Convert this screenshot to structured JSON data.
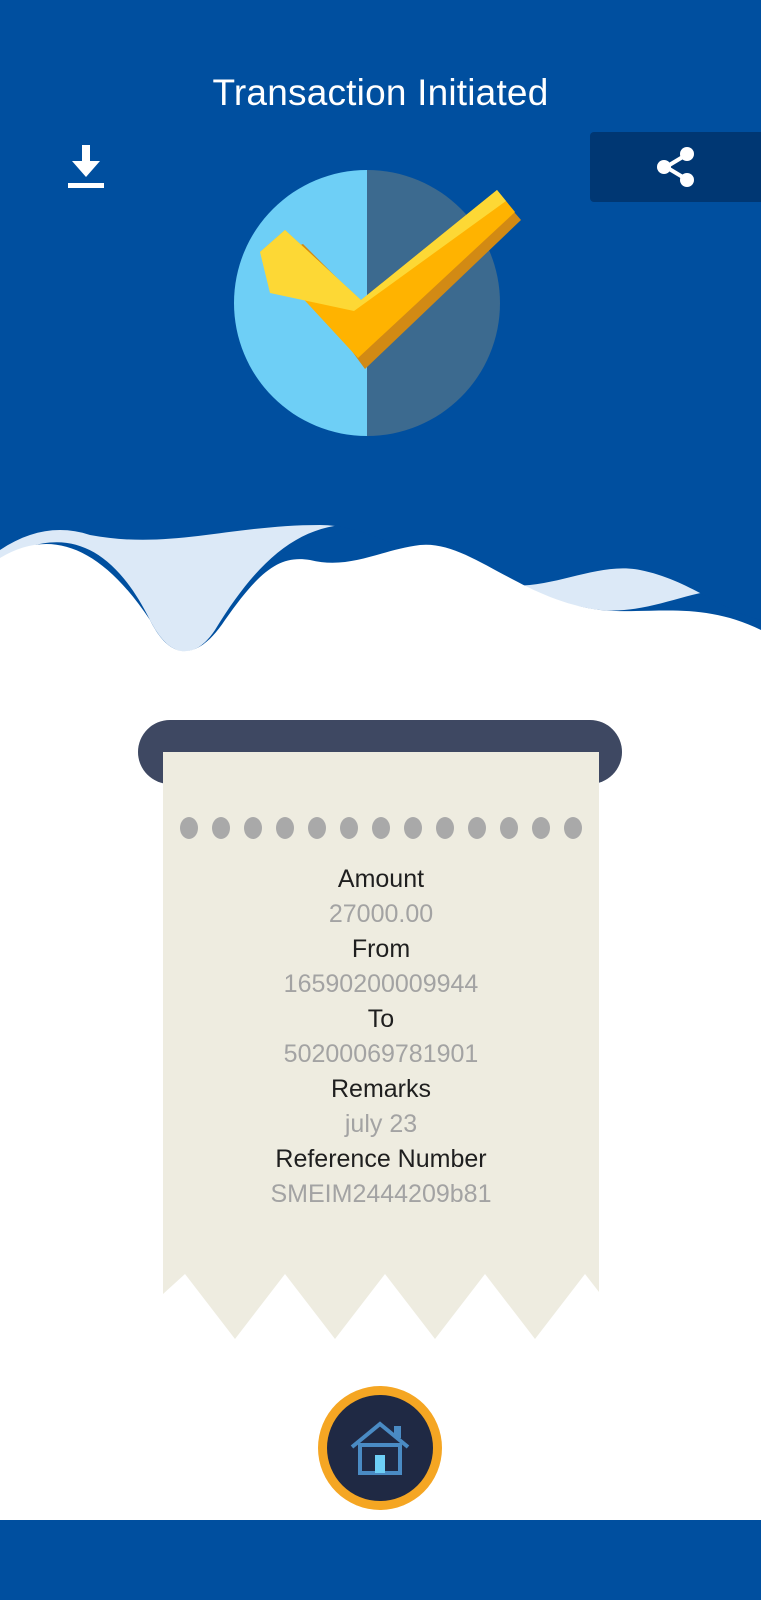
{
  "header": {
    "title": "Transaction Initiated",
    "download_icon": "download-icon",
    "share_icon": "share-icon"
  },
  "status_icon": "success-checkmark-icon",
  "receipt": {
    "fields": [
      {
        "label": "Amount",
        "value": "27000.00"
      },
      {
        "label": "From",
        "value": "16590200009944"
      },
      {
        "label": "To",
        "value": "50200069781901"
      },
      {
        "label": "Remarks",
        "value": "july 23"
      },
      {
        "label": "Reference Number",
        "value": "SMEIM2444209b81"
      }
    ]
  },
  "footer": {
    "home_icon": "home-icon"
  },
  "colors": {
    "primary": "#004f9f",
    "share_button_bg": "#003773",
    "receipt_paper": "#eeece0",
    "receipt_holder": "#3e4862",
    "home_ring": "#f5a623",
    "home_inner": "#1f2944"
  }
}
